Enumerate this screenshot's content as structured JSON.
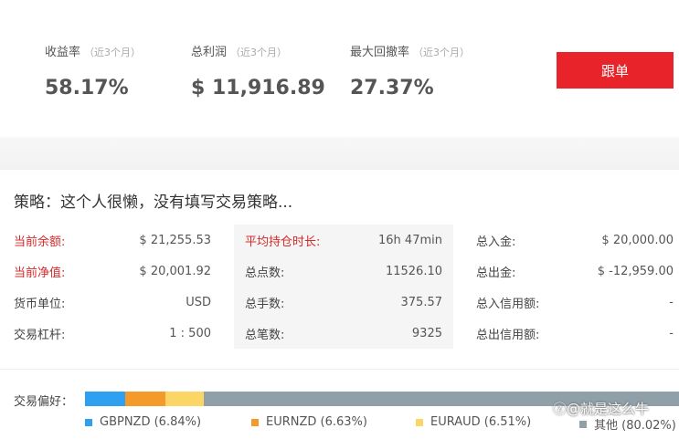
{
  "stats": [
    {
      "label": "收益率",
      "period": "（近3个月）",
      "value": "58.17%"
    },
    {
      "label": "总利润",
      "period": "（近3个月）",
      "value": "$ 11,916.89"
    },
    {
      "label": "最大回撤率",
      "period": "（近3个月）",
      "value": "27.37%"
    }
  ],
  "follow_button": {
    "label": "跟单",
    "color": "#e8242a"
  },
  "strategy": {
    "title": "策略：这个人很懒，没有填写交易策略..."
  },
  "info": {
    "col1": [
      {
        "label": "当前余额:",
        "value": "$ 21,255.53",
        "highlight": true
      },
      {
        "label": "当前净值:",
        "value": "$ 20,001.92",
        "highlight": true
      },
      {
        "label": "货币单位:",
        "value": "USD",
        "highlight": false
      },
      {
        "label": "交易杠杆:",
        "value": "1 : 500",
        "highlight": false
      }
    ],
    "col2": [
      {
        "label": "平均持仓时长:",
        "value": "16h 47min",
        "highlight": true
      },
      {
        "label": "总点数:",
        "value": "11526.10",
        "highlight": false
      },
      {
        "label": "总手数:",
        "value": "375.57",
        "highlight": false
      },
      {
        "label": "总笔数:",
        "value": "9325",
        "highlight": false
      }
    ],
    "col3": [
      {
        "label": "总入金:",
        "value": "$ 20,000.00",
        "highlight": false
      },
      {
        "label": "总出金:",
        "value": "$ -12,959.00",
        "highlight": false
      },
      {
        "label": "总入信用额:",
        "value": "-",
        "highlight": false
      },
      {
        "label": "总出信用额:",
        "value": "-",
        "highlight": false
      }
    ]
  },
  "preference": {
    "label": "交易偏好：",
    "segments": [
      {
        "name": "GBPNZD",
        "percent": 6.84,
        "display": "GBPNZD (6.84%)",
        "color": "#2f9ff0"
      },
      {
        "name": "EURNZD",
        "percent": 6.63,
        "display": "EURNZD (6.63%)",
        "color": "#f39a2b"
      },
      {
        "name": "EURAUD",
        "percent": 6.51,
        "display": "EURAUD (6.51%)",
        "color": "#fbd667"
      },
      {
        "name": "其他",
        "percent": 80.02,
        "display": "其他 (80.02%)",
        "color": "#8fa0a8"
      }
    ]
  },
  "watermark": {
    "text": "@就是这么牛",
    "icon": "zhihu-logo-icon"
  }
}
